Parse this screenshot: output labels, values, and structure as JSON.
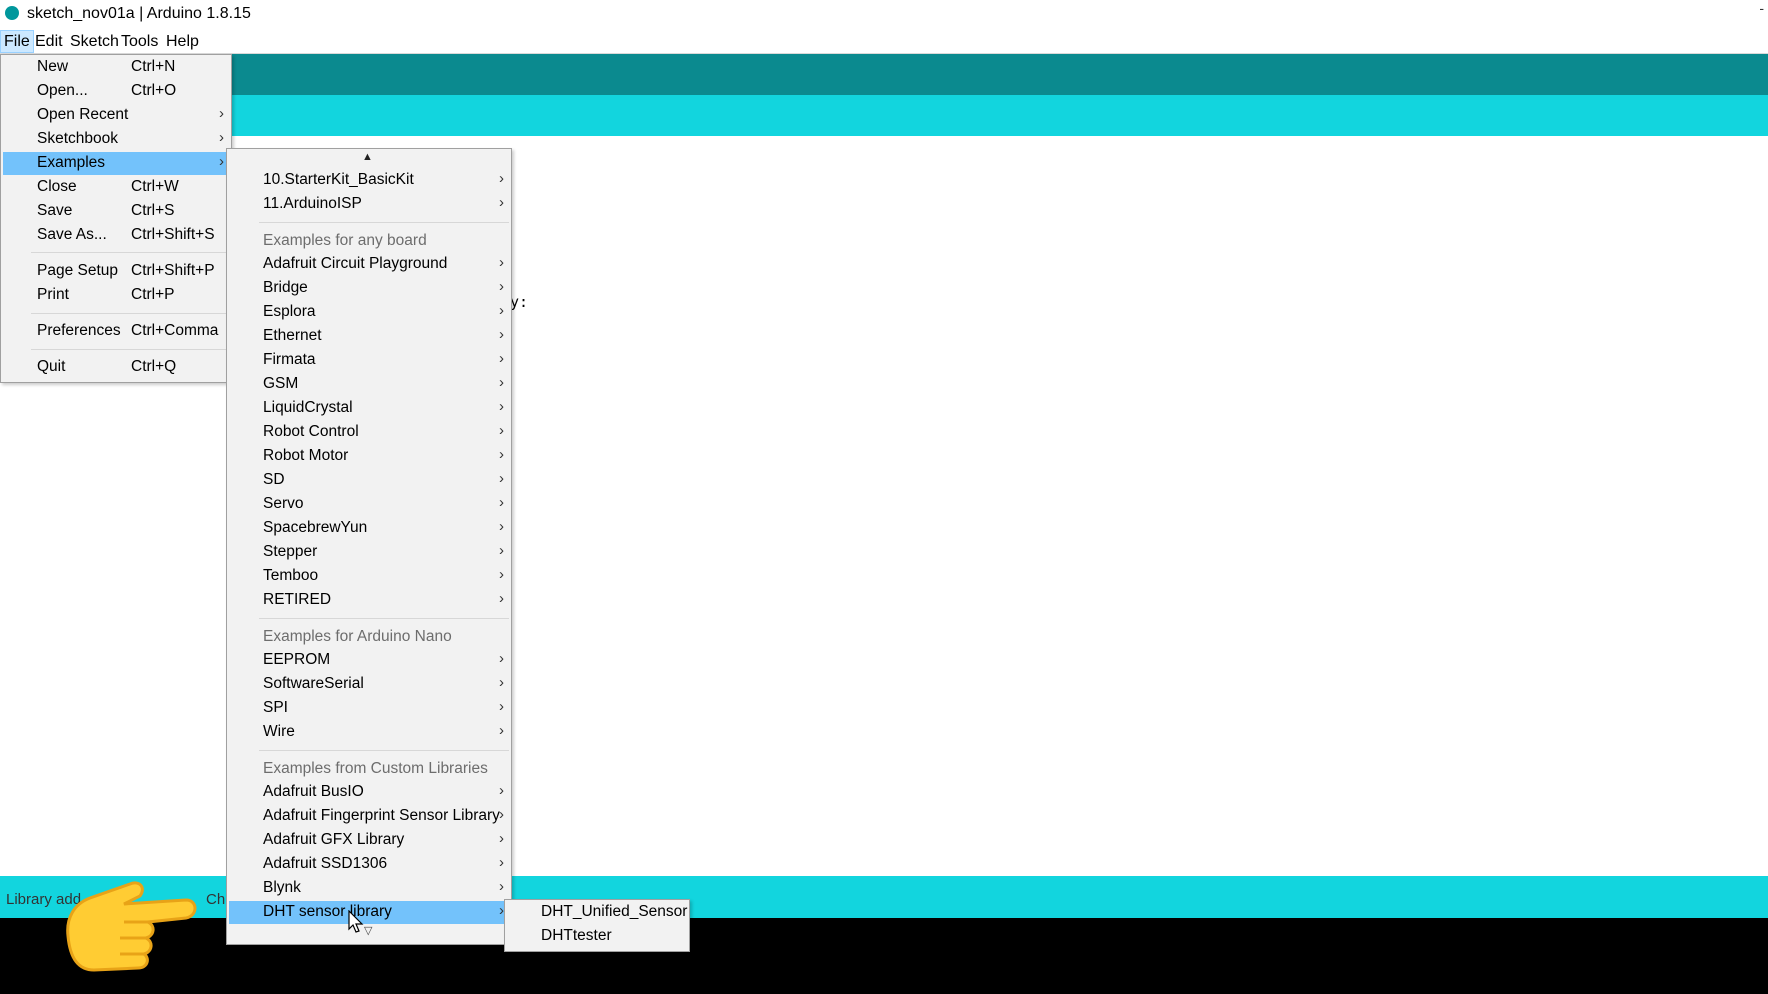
{
  "window": {
    "title": "sketch_nov01a | Arduino 1.8.15",
    "minimize": "-"
  },
  "menubar": {
    "items": [
      "File",
      "Edit",
      "Sketch",
      "Tools",
      "Help"
    ]
  },
  "file_menu": {
    "items": [
      {
        "label": "New",
        "shortcut": "Ctrl+N"
      },
      {
        "label": "Open...",
        "shortcut": "Ctrl+O"
      },
      {
        "label": "Open Recent",
        "shortcut": ""
      },
      {
        "label": "Sketchbook",
        "shortcut": ""
      },
      {
        "label": "Examples",
        "shortcut": ""
      },
      {
        "label": "Close",
        "shortcut": "Ctrl+W"
      },
      {
        "label": "Save",
        "shortcut": "Ctrl+S"
      },
      {
        "label": "Save As...",
        "shortcut": "Ctrl+Shift+S"
      },
      {
        "label": "Page Setup",
        "shortcut": "Ctrl+Shift+P"
      },
      {
        "label": "Print",
        "shortcut": "Ctrl+P"
      },
      {
        "label": "Preferences",
        "shortcut": "Ctrl+Comma"
      },
      {
        "label": "Quit",
        "shortcut": "Ctrl+Q"
      }
    ]
  },
  "examples_menu": {
    "scroll_up": "▲",
    "scroll_down": "▽",
    "builtin": [
      "10.StarterKit_BasicKit",
      "11.ArduinoISP"
    ],
    "any_board_header": "Examples for any board",
    "any_board": [
      "Adafruit Circuit Playground",
      "Bridge",
      "Esplora",
      "Ethernet",
      "Firmata",
      "GSM",
      "LiquidCrystal",
      "Robot Control",
      "Robot Motor",
      "SD",
      "Servo",
      "SpacebrewYun",
      "Stepper",
      "Temboo",
      "RETIRED"
    ],
    "nano_header": "Examples for Arduino Nano",
    "nano": [
      "EEPROM",
      "SoftwareSerial",
      "SPI",
      "Wire"
    ],
    "custom_header": "Examples from Custom Libraries",
    "custom": [
      "Adafruit BusIO",
      "Adafruit Fingerprint Sensor Library",
      "Adafruit GFX Library",
      "Adafruit SSD1306",
      "Blynk",
      "DHT sensor library"
    ]
  },
  "dht_submenu": {
    "items": [
      "DHT_Unified_Sensor",
      "DHTtester"
    ]
  },
  "editor": {
    "visible_fragment": "y:"
  },
  "status": {
    "text": "Library add",
    "text_right": "Ch"
  },
  "colors": {
    "toolbar": "#0b8a8f",
    "tabbar": "#12d5de",
    "highlight": "#73c2fb",
    "console": "#000000"
  },
  "icons": {
    "app": "arduino-logo-icon",
    "pointer": "pointing-hand-icon",
    "cursor": "mouse-cursor-icon",
    "submenu": "chevron-right-icon"
  }
}
